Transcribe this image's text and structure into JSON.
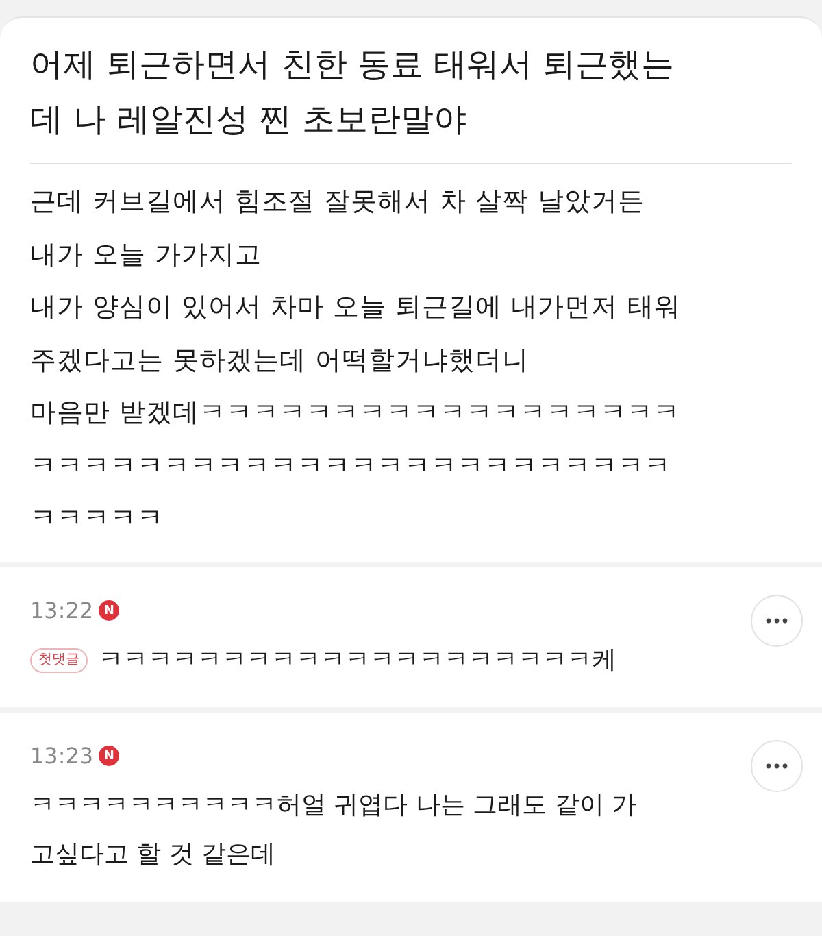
{
  "post": {
    "title_lines": [
      "어제 퇴근하면서 친한 동료 태워서 퇴근했는",
      "데 나 레알진성 찐 초보란말야"
    ],
    "body_lines": [
      "근데 커브길에서 힘조절 잘못해서 차 살짝 날았거든",
      "내가 오늘 가가지고",
      "내가 양심이 있어서 차마 오늘 퇴근길에 내가먼저 태워",
      "주겠다고는 못하겠는데 어떡할거냐했더니",
      "마음만 받겠데ㅋㅋㅋㅋㅋㅋㅋㅋㅋㅋㅋㅋㅋㅋㅋㅋㅋㅋ",
      "ㅋㅋㅋㅋㅋㅋㅋㅋㅋㅋㅋㅋㅋㅋㅋㅋㅋㅋㅋㅋㅋㅋㅋㅋ",
      "ㅋㅋㅋㅋㅋ"
    ]
  },
  "comments": [
    {
      "time": "13:22",
      "new_mark": "N",
      "badge": "첫댓글",
      "text_lines": [
        "ㅋㅋㅋㅋㅋㅋㅋㅋㅋㅋㅋㅋㅋㅋㅋㅋㅋㅋㅋㅋ케"
      ]
    },
    {
      "time": "13:23",
      "new_mark": "N",
      "text_lines": [
        "ㅋㅋㅋㅋㅋㅋㅋㅋㅋㅋ허얼 귀엽다 나는 그래도 같이 가",
        "고싶다고 할 것 같은데"
      ]
    }
  ]
}
